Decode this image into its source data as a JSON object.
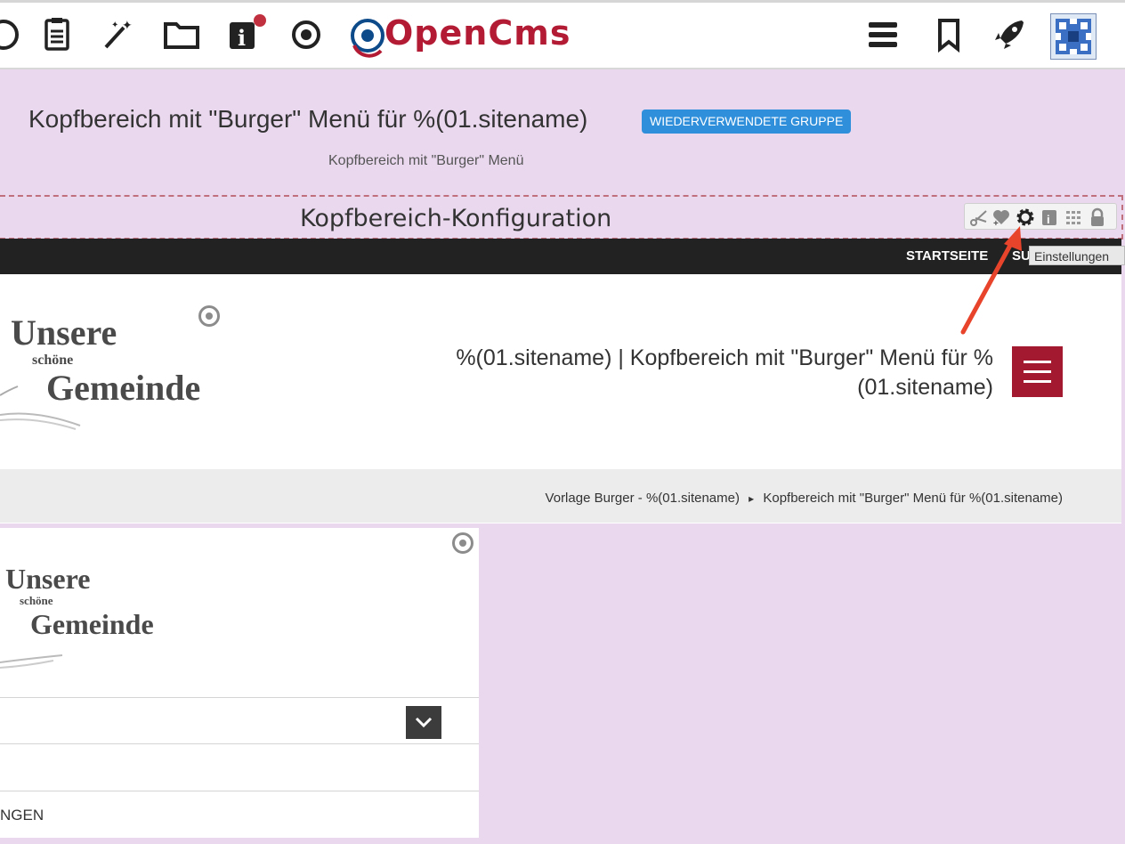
{
  "toolbar": {
    "logo_text": "OpenCms",
    "icons": [
      "circle-icon",
      "clipboard-icon",
      "magic-wand-icon",
      "folder-icon",
      "info-icon",
      "target-icon",
      "hamburger-icon",
      "bookmark-icon",
      "rocket-icon",
      "avatar"
    ]
  },
  "group": {
    "title": "Kopfbereich mit \"Burger\" Menü für %(01.sitename)",
    "badge": "WIEDERVERWENDETE GRUPPE",
    "subtitle": "Kopfbereich mit \"Burger\" Menü"
  },
  "element": {
    "label": "Kopfbereich-Konfiguration",
    "tooltip": "Einstellungen"
  },
  "page": {
    "nav_start": "STARTSEITE",
    "nav_more": "SU",
    "logo_line1": "Unsere",
    "logo_line2": "schöne",
    "logo_line3": "Gemeinde",
    "site_title": "%(01.sitename) | Kopfbereich mit \"Burger\" Menü für %(01.sitename)",
    "breadcrumb": {
      "first": "Vorlage Burger - %(01.sitename)",
      "separator": "▸",
      "second": "Kopfbereich mit \"Burger\" Menü für %(01.sitename)"
    },
    "lower_text": "NGEN"
  },
  "colors": {
    "accent": "#a3192f",
    "badge": "#2f8fdb",
    "background": "#ead8ef",
    "arrow": "#e8442c"
  }
}
